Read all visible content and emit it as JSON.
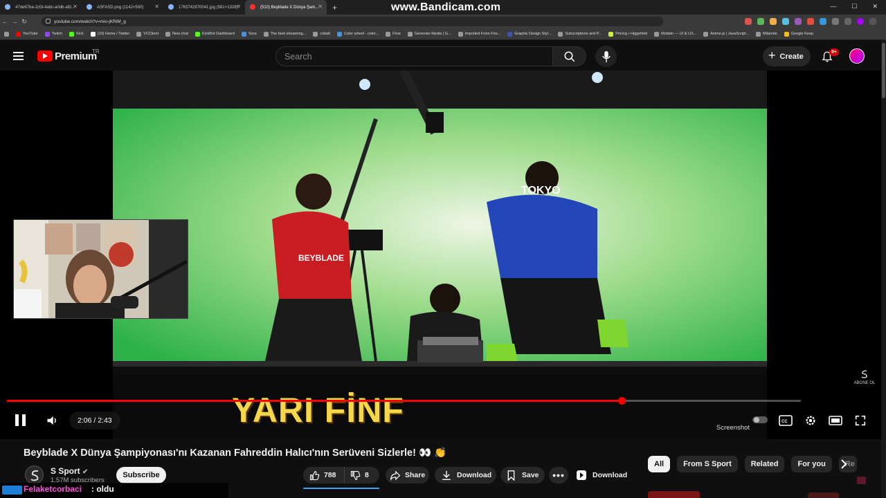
{
  "browser": {
    "watermark": "www.Bandicam.com",
    "tabs": [
      {
        "label": "47de67ba-2cfd-4abc-a0db-afd...",
        "active": false
      },
      {
        "label": "ASFASD.png (1142×500)",
        "active": false
      },
      {
        "label": "1763742870041.jpg (581×1328)",
        "active": false
      },
      {
        "label": "(510) Beyblade X Dünya Şam...",
        "active": true
      }
    ],
    "url": "youtube.com/watch?v=mio-jKRiM_g",
    "bookmarks": [
      "YouTube",
      "Twitch",
      "Kick",
      "(10) Home / Twitter",
      "VCClient",
      "New chat",
      "KickBot Dashboard",
      "Sora",
      "The best streaming...",
      "cobalt",
      "Color wheel - color...",
      "Flow",
      "Generate Media | G...",
      "Imported From Fire...",
      "Graphic Design Styl...",
      "Subscriptions and P...",
      "Pricing • Higgsfield",
      "Mobbin — UI & UX...",
      "Anime.js | JavaScript...",
      "Milanote",
      "Google Keep"
    ]
  },
  "masthead": {
    "brand": "Premium",
    "country": "TR",
    "search_placeholder": "Search",
    "create_label": "Create",
    "notification_count": "9+"
  },
  "player": {
    "time": "2:06 / 2:43",
    "progress_fraction": 0.775,
    "caption": "YARI FİNF",
    "screenshot_label": "Screenshot",
    "abone_label": "ABONE OL",
    "jersey_text": "TOKYO",
    "shirt_text": "BEYBLADE"
  },
  "video": {
    "title": "Beyblade X Dünya Şampiyonası'nı Kazanan Fahreddin Halıcı'nın Serüveni Sizlerle! 👀 👏",
    "channel_name": "S Sport",
    "subscribers": "1.57M subscribers",
    "subscribe_label": "Subscribe",
    "likes": "788",
    "dislikes": "8",
    "share_label": "Share",
    "download_label": "Download",
    "save_label": "Save",
    "download2_label": "Download"
  },
  "chat": {
    "user": "Felaketcorbaci",
    "message": ": oldu"
  },
  "chips": [
    "All",
    "From S Sport",
    "Related",
    "For you",
    "Re"
  ],
  "colors": {
    "accent": "#ff0000",
    "background": "#0f0f0f",
    "caption_yellow": "#f6d64a",
    "chat_user": "#ff4fd8"
  }
}
